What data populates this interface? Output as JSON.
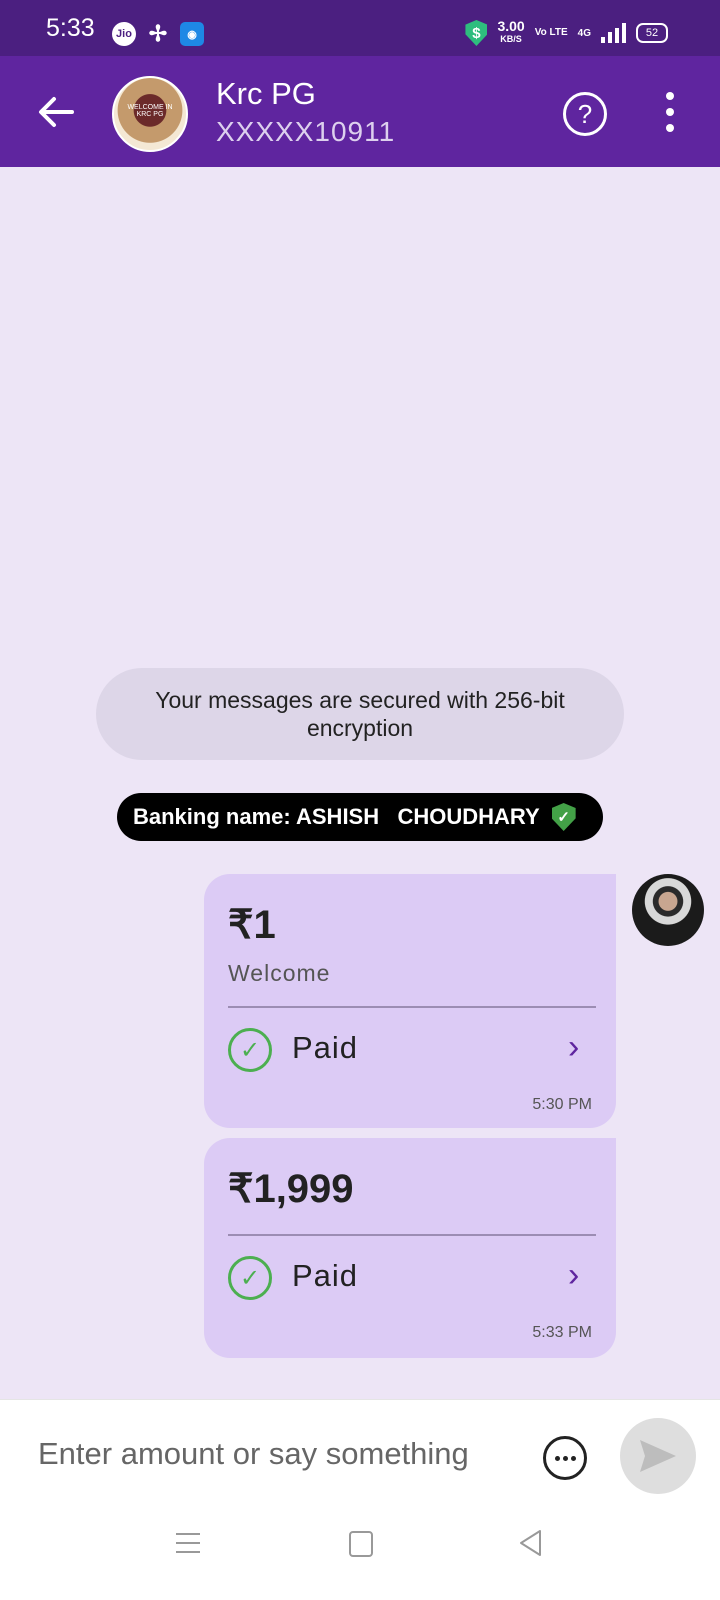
{
  "status_bar": {
    "time": "5:33",
    "network_speed": "3.00",
    "network_speed_unit": "KB/S",
    "volte": "Vo LTE",
    "network_type": "4G",
    "battery": "52",
    "icons": [
      "jio-icon",
      "pinwheel-icon",
      "android-app-icon",
      "shield-dollar-icon",
      "signal-icon",
      "battery-icon"
    ]
  },
  "header": {
    "contact_name": "Krc PG",
    "contact_phone": "XXXXX10911",
    "avatar_text": "WELCOME IN KRC PG",
    "accent_color": "#5f259f"
  },
  "chat": {
    "encryption_notice": "Your messages are secured with 256-bit encryption",
    "banking_name": "Banking name: ASHISH   CHOUDHARY",
    "payments": [
      {
        "amount": "₹1",
        "note": "Welcome",
        "status": "Paid",
        "time": "5:30 PM"
      },
      {
        "amount": "₹1,999",
        "note": "",
        "status": "Paid",
        "time": "5:33 PM"
      }
    ]
  },
  "composer": {
    "placeholder": "Enter amount or say something"
  }
}
